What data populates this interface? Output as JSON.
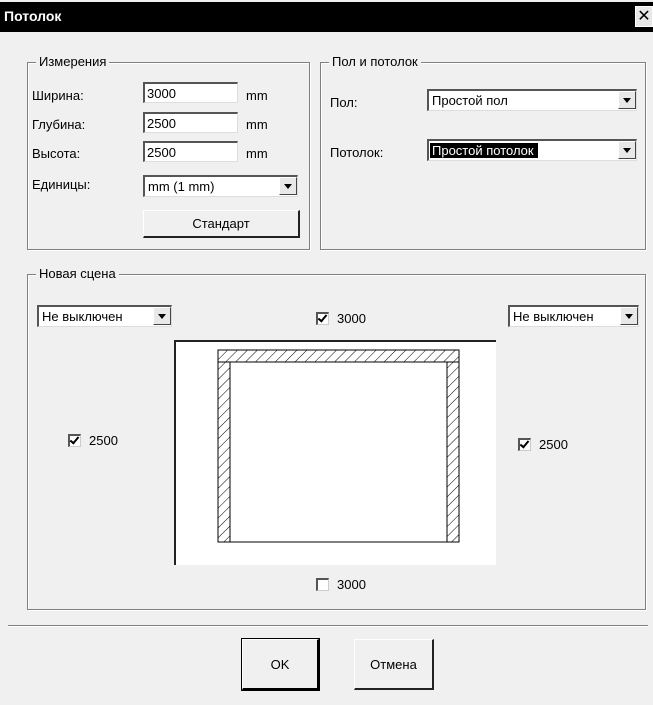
{
  "window": {
    "title": "Потолок",
    "close_label": "✕"
  },
  "dimensions": {
    "group_title": "Измерения",
    "width_label": "Ширина:",
    "width_value": "3000",
    "width_unit": "mm",
    "depth_label": "Глубина:",
    "depth_value": "2500",
    "depth_unit": "mm",
    "height_label": "Высота:",
    "height_value": "2500",
    "height_unit": "mm",
    "units_label": "Единицы:",
    "units_value": "mm (1 mm)",
    "standard_button": "Стандарт"
  },
  "floor_ceiling": {
    "group_title": "Пол и потолок",
    "floor_label": "Пол:",
    "floor_value": "Простой пол",
    "ceiling_label": "Потолок:",
    "ceiling_value": "Простой потолок"
  },
  "new_scene": {
    "group_title": "Новая сцена",
    "left_combo_value": "Не выключен",
    "right_combo_value": "Не выключен",
    "top_check": {
      "label": "3000",
      "checked": true
    },
    "left_check": {
      "label": "2500",
      "checked": true
    },
    "right_check": {
      "label": "2500",
      "checked": true
    },
    "bottom_check": {
      "label": "3000",
      "checked": false
    }
  },
  "footer": {
    "ok_label": "OK",
    "cancel_label": "Отмена"
  }
}
